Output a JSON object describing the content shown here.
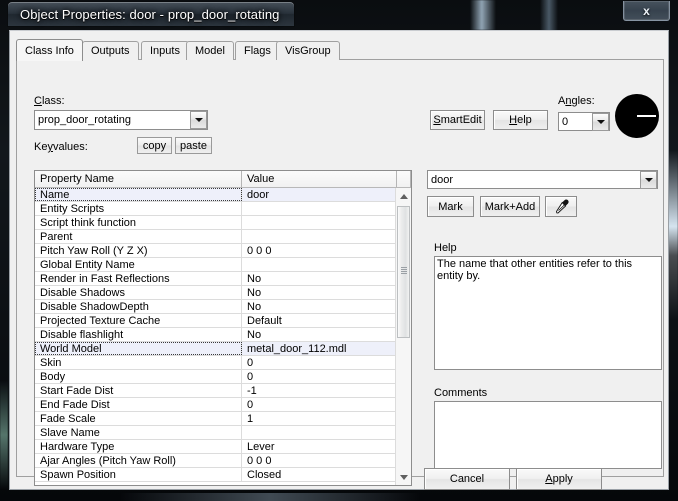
{
  "window": {
    "title": "Object Properties: door - prop_door_rotating",
    "close_label": "x",
    "close_icon": "close-icon"
  },
  "tabs": [
    {
      "label": "Class Info",
      "active": true
    },
    {
      "label": "Outputs",
      "active": false
    },
    {
      "label": "Inputs",
      "active": false
    },
    {
      "label": "Model",
      "active": false
    },
    {
      "label": "Flags",
      "active": false
    },
    {
      "label": "VisGroup",
      "active": false
    }
  ],
  "class_section": {
    "label": "Class:",
    "value": "prop_door_rotating",
    "keyvalues_label": "Keyvalues:",
    "copy_label": "copy",
    "paste_label": "paste"
  },
  "grid": {
    "headers": [
      "Property Name",
      "Value"
    ],
    "selected_index": 0,
    "highlighted_index": 11,
    "rows": [
      {
        "name": "Name",
        "value": "door"
      },
      {
        "name": "Entity Scripts",
        "value": ""
      },
      {
        "name": "Script think function",
        "value": ""
      },
      {
        "name": "Parent",
        "value": ""
      },
      {
        "name": "Pitch Yaw Roll (Y Z X)",
        "value": "0 0 0"
      },
      {
        "name": "Global Entity Name",
        "value": ""
      },
      {
        "name": "Render in Fast Reflections",
        "value": "No"
      },
      {
        "name": "Disable Shadows",
        "value": "No"
      },
      {
        "name": "Disable ShadowDepth",
        "value": "No"
      },
      {
        "name": "Projected Texture Cache",
        "value": "Default"
      },
      {
        "name": "Disable flashlight",
        "value": "No"
      },
      {
        "name": "World Model",
        "value": "metal_door_112.mdl"
      },
      {
        "name": "Skin",
        "value": "0"
      },
      {
        "name": "Body",
        "value": "0"
      },
      {
        "name": "Start Fade Dist",
        "value": "-1"
      },
      {
        "name": "End Fade Dist",
        "value": "0"
      },
      {
        "name": "Fade Scale",
        "value": "1"
      },
      {
        "name": "Slave Name",
        "value": ""
      },
      {
        "name": "Hardware Type",
        "value": "Lever"
      },
      {
        "name": "Ajar Angles (Pitch Yaw Roll)",
        "value": "0 0 0"
      },
      {
        "name": "Spawn Position",
        "value": "Closed"
      }
    ]
  },
  "right_panel": {
    "smartedit_label": "SmartEdit",
    "help_button_label": "Help",
    "angles_label": "Angles:",
    "angles_value": "0",
    "angle_dial_icon": "angle-dial-icon",
    "name_value": "door",
    "mark_label": "Mark",
    "mark_add_label": "Mark+Add",
    "eyedropper_icon": "eyedropper-icon",
    "help_group_label": "Help",
    "help_text": "The name that other entities refer to this entity by.",
    "comments_label": "Comments",
    "comments_value": ""
  },
  "footer": {
    "cancel_label": "Cancel",
    "apply_label": "Apply"
  },
  "colors": {
    "dialog_bg": "#f0f0f0",
    "field_bg": "#ffffff",
    "selection_bg": "#eef0fa",
    "frame_dark": "#0a0d10"
  }
}
